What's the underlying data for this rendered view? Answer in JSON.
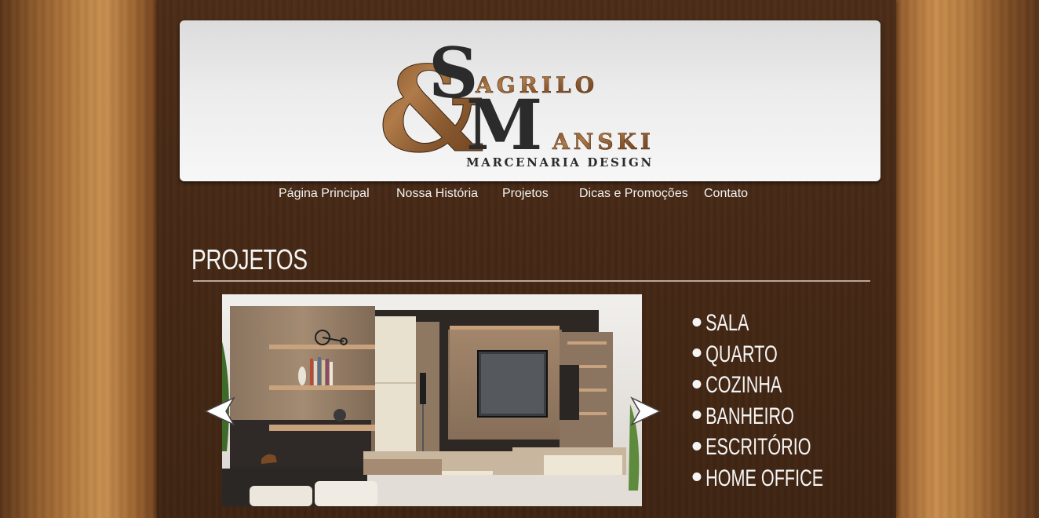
{
  "logo": {
    "letter_s": "S",
    "agrilo": "AGRILO",
    "ampersand": "&",
    "letter_m": "M",
    "anski": "ANSKI",
    "tagline": "MARCENARIA DESIGN"
  },
  "nav": {
    "items": [
      {
        "label": "Página Principal"
      },
      {
        "label": "Nossa História"
      },
      {
        "label": "Projetos"
      },
      {
        "label": "Dicas e Promoções"
      },
      {
        "label": "Contato"
      }
    ]
  },
  "section": {
    "title": "PROJETOS"
  },
  "slideshow": {
    "image": "living-room-furniture-photo"
  },
  "categories": [
    {
      "label": "SALA"
    },
    {
      "label": "QUARTO"
    },
    {
      "label": "COZINHA"
    },
    {
      "label": "BANHEIRO"
    },
    {
      "label": "ESCRITÓRIO"
    },
    {
      "label": "HOME OFFICE"
    }
  ],
  "colors": {
    "wood_dark": "#3f2412",
    "wood_light": "#c98f4f",
    "logo_dark": "#2b2b2b",
    "logo_wood": "#a0693a"
  }
}
